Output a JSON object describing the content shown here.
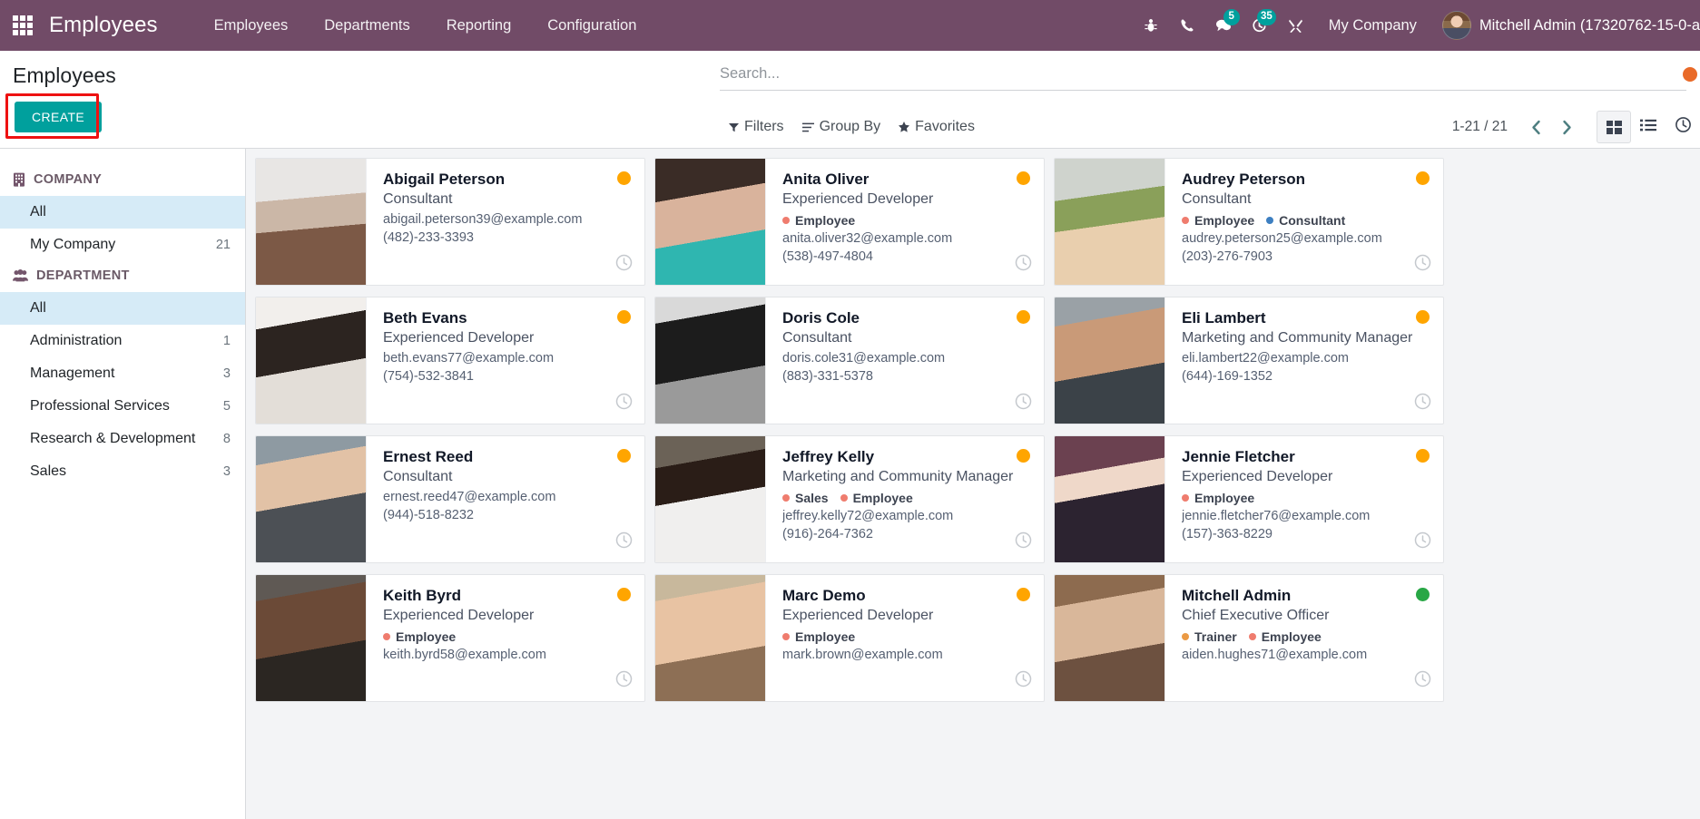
{
  "navbar": {
    "apps_icon": "apps-grid-icon",
    "brand": "Employees",
    "menu": [
      {
        "label": "Employees"
      },
      {
        "label": "Departments"
      },
      {
        "label": "Reporting"
      },
      {
        "label": "Configuration"
      }
    ],
    "icons": [
      {
        "name": "bug-icon",
        "badge": ""
      },
      {
        "name": "phone-icon",
        "badge": ""
      },
      {
        "name": "messages-icon",
        "badge": "5"
      },
      {
        "name": "activities-clock-icon",
        "badge": "35"
      },
      {
        "name": "tools-icon",
        "badge": ""
      }
    ],
    "company": "My Company",
    "user": "Mitchell Admin (17320762-15-0-a"
  },
  "control_panel": {
    "title": "Employees",
    "create_label": "CREATE",
    "search_placeholder": "Search...",
    "search_value": "",
    "filters_label": "Filters",
    "group_by_label": "Group By",
    "favorites_label": "Favorites",
    "pager": "1-21 / 21",
    "views": [
      {
        "name": "kanban",
        "active": true
      },
      {
        "name": "list",
        "active": false
      },
      {
        "name": "activity",
        "active": false
      }
    ]
  },
  "sidebar": {
    "company_section": "COMPANY",
    "company_items": [
      {
        "label": "All",
        "count": "",
        "selected": true
      },
      {
        "label": "My Company",
        "count": "21",
        "selected": false
      }
    ],
    "department_section": "DEPARTMENT",
    "department_items": [
      {
        "label": "All",
        "count": "",
        "selected": true
      },
      {
        "label": "Administration",
        "count": "1",
        "selected": false
      },
      {
        "label": "Management",
        "count": "3",
        "selected": false
      },
      {
        "label": "Professional Services",
        "count": "5",
        "selected": false
      },
      {
        "label": "Research & Development",
        "count": "8",
        "selected": false
      },
      {
        "label": "Sales",
        "count": "3",
        "selected": false
      }
    ]
  },
  "colors": {
    "brand_purple": "#714B67",
    "accent_teal": "#00A09D",
    "status_orange": "#FFA500",
    "status_green": "#28A745",
    "tag_red": "#ef7c6e",
    "tag_blue": "#3d7fc1",
    "tag_orange": "#eb9a44",
    "selection_blue": "#d6ebf7",
    "highlight_red": "#ee1111"
  },
  "employees": [
    {
      "name": "Abigail Peterson",
      "job": "Consultant",
      "tags": [],
      "email": "abigail.peterson39@example.com",
      "phone": "(482)-233-3393",
      "status": "orange",
      "photo": "linear-gradient(175deg,#e8e6e4 0 32%,#cbb7a7 32% 55%,#7c5946 55% 100%)"
    },
    {
      "name": "Anita Oliver",
      "job": "Experienced Developer",
      "tags": [
        {
          "label": "Employee",
          "color": "tag_red"
        }
      ],
      "email": "anita.oliver32@example.com",
      "phone": "(538)-497-4804",
      "status": "orange",
      "photo": "linear-gradient(170deg,#3a2c26 0 30%,#d9b39c 30% 62%,#2fb6b0 62% 100%)"
    },
    {
      "name": "Audrey Peterson",
      "job": "Consultant",
      "tags": [
        {
          "label": "Employee",
          "color": "tag_red"
        },
        {
          "label": "Consultant",
          "color": "tag_blue"
        }
      ],
      "email": "audrey.peterson25@example.com",
      "phone": "(203)-276-7903",
      "status": "orange",
      "photo": "linear-gradient(172deg,#cfd3cd 0 30%,#8aa05a 30% 52%,#e9cfae 52% 100%)"
    },
    {
      "name": "Beth Evans",
      "job": "Experienced Developer",
      "tags": [],
      "email": "beth.evans77@example.com",
      "phone": "(754)-532-3841",
      "status": "orange",
      "photo": "linear-gradient(170deg,#f2efec 0 22%,#2c2420 22% 55%,#e3ded8 55% 100%)"
    },
    {
      "name": "Doris Cole",
      "job": "Consultant",
      "tags": [],
      "email": "doris.cole31@example.com",
      "phone": "(883)-331-5378",
      "status": "orange",
      "photo": "linear-gradient(170deg,#d9d9d9 0 18%,#1c1c1c 18% 60%,#9a9a9a 60% 100%)"
    },
    {
      "name": "Eli Lambert",
      "job": "Marketing and Community Manager",
      "tags": [],
      "email": "eli.lambert22@example.com",
      "phone": "(644)-169-1352",
      "status": "orange",
      "photo": "linear-gradient(170deg,#9aa1a6 0 20%,#c99a78 20% 58%,#3b4248 58% 100%)"
    },
    {
      "name": "Ernest Reed",
      "job": "Consultant",
      "tags": [],
      "email": "ernest.reed47@example.com",
      "phone": "(944)-518-8232",
      "status": "orange",
      "photo": "linear-gradient(170deg,#8e9aa2 0 20%,#e2c2a6 20% 52%,#4c5055 52% 100%)"
    },
    {
      "name": "Jeffrey Kelly",
      "job": "Marketing and Community Manager",
      "tags": [
        {
          "label": "Sales",
          "color": "tag_red"
        },
        {
          "label": "Employee",
          "color": "tag_red"
        }
      ],
      "email": "jeffrey.kelly72@example.com",
      "phone": "(916)-264-7362",
      "status": "orange",
      "photo": "linear-gradient(170deg,#6b6257 0 22%,#2a1d17 22% 48%,#f0efee 48% 100%)"
    },
    {
      "name": "Jennie Fletcher",
      "job": "Experienced Developer",
      "tags": [
        {
          "label": "Employee",
          "color": "tag_red"
        }
      ],
      "email": "jennie.fletcher76@example.com",
      "phone": "(157)-363-8229",
      "status": "orange",
      "photo": "linear-gradient(170deg,#6b4150 0 28%,#efd8c9 28% 46%,#2c2330 46% 100%)"
    },
    {
      "name": "Keith Byrd",
      "job": "Experienced Developer",
      "tags": [
        {
          "label": "Employee",
          "color": "tag_red"
        }
      ],
      "email": "keith.byrd58@example.com",
      "phone": "",
      "status": "orange",
      "photo": "linear-gradient(170deg,#5f5954 0 18%,#6b4a37 18% 58%,#2b2622 58% 100%)"
    },
    {
      "name": "Marc Demo",
      "job": "Experienced Developer",
      "tags": [
        {
          "label": "Employee",
          "color": "tag_red"
        }
      ],
      "email": "mark.brown@example.com",
      "phone": "",
      "status": "orange",
      "photo": "linear-gradient(170deg,#c8b89c 0 18%,#e8c3a3 18% 62%,#8d6f55 62% 100%)"
    },
    {
      "name": "Mitchell Admin",
      "job": "Chief Executive Officer",
      "tags": [
        {
          "label": "Trainer",
          "color": "tag_orange"
        },
        {
          "label": "Employee",
          "color": "tag_red"
        }
      ],
      "email": "aiden.hughes71@example.com",
      "phone": "",
      "status": "green",
      "photo": "linear-gradient(170deg,#8d6b4f 0 22%,#d9b79a 22% 60%,#6d5140 60% 100%)"
    }
  ]
}
